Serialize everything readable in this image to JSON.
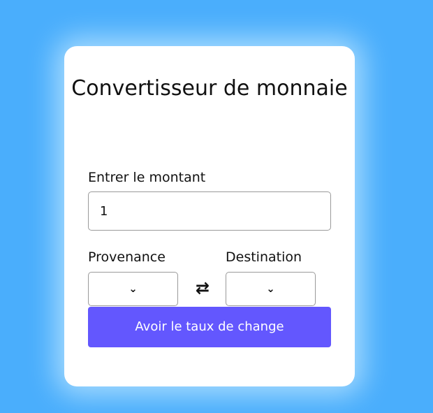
{
  "form": {
    "title": "Convertisseur de monnaie",
    "amount_label": "Entrer le montant",
    "amount_value": "1",
    "from_label": "Provenance",
    "to_label": "Destination",
    "from_selected": "",
    "to_selected": "",
    "submit_label": "Avoir le taux de change"
  },
  "icons": {
    "dropdown": "chevron-down-icon",
    "swap": "swap-arrows-icon"
  },
  "colors": {
    "background": "#4aaefc",
    "card": "#ffffff",
    "accent": "#6357fe"
  }
}
